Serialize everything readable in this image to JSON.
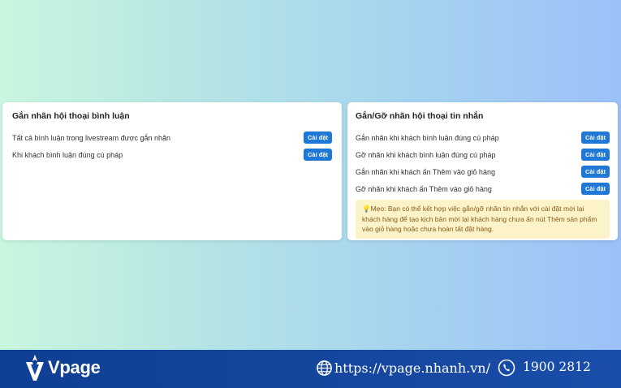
{
  "left_panel": {
    "title": "Gắn nhãn hội thoại bình luận",
    "rows": [
      {
        "label": "Tất cả bình luận trong livestream được gắn nhãn",
        "button": "Cài đặt"
      },
      {
        "label": "Khi khách bình luận đúng cú pháp",
        "button": "Cài đặt"
      }
    ]
  },
  "right_panel": {
    "title": "Gắn/Gỡ nhãn hội thoại tin nhắn",
    "rows": [
      {
        "label": "Gắn nhãn khi khách bình luận đúng cú pháp",
        "button": "Cài đặt"
      },
      {
        "label": "Gỡ nhãn khi khách bình luận đúng cú pháp",
        "button": "Cài đặt"
      },
      {
        "label": "Gắn nhãn khi khách ấn Thêm vào giỏ hàng",
        "button": "Cài đặt"
      },
      {
        "label": "Gỡ nhãn khi khách ấn Thêm vào giỏ hàng",
        "button": "Cài đặt"
      }
    ],
    "tip": "Mẹo: Bạn có thể kết hợp việc gắn/gỡ nhãn tin nhắn với cài đặt mời lại khách hàng để tạo kịch bản mời lại khách hàng chưa ấn nút Thêm sản phẩm vào giỏ hàng hoặc chưa hoàn tất đặt hàng."
  },
  "footer": {
    "brand": "Vpage",
    "url": "https://vpage.nhanh.vn/",
    "phone": "1900 2812"
  },
  "colors": {
    "button": "#1f78d6",
    "tip_background": "#fdf3c9",
    "footer": "#1647a0"
  },
  "icons": [
    "lightbulb-icon",
    "vpage-logo-icon",
    "globe-icon",
    "phone-icon"
  ]
}
